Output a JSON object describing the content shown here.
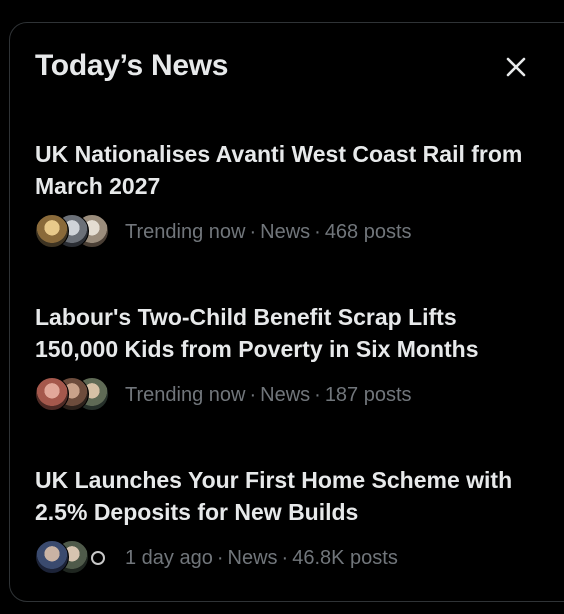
{
  "panel": {
    "title": "Today’s News",
    "close_icon": "close-icon"
  },
  "colors": {
    "background": "#000000",
    "headline": "#e7e9ea",
    "meta": "#71767b",
    "border": "#2f3336"
  },
  "news": [
    {
      "headline": "UK Nationalises Avanti West Coast Rail from March 2027",
      "time": "Trending now",
      "category": "News",
      "posts": "468 posts"
    },
    {
      "headline": "Labour's Two-Child Benefit Scrap Lifts 150,000 Kids from Poverty in Six Months",
      "time": "Trending now",
      "category": "News",
      "posts": "187 posts"
    },
    {
      "headline": "UK Launches Your First Home Scheme with 2.5% Deposits for New Builds",
      "time": "1 day ago",
      "category": "News",
      "posts": "46.8K posts"
    }
  ]
}
